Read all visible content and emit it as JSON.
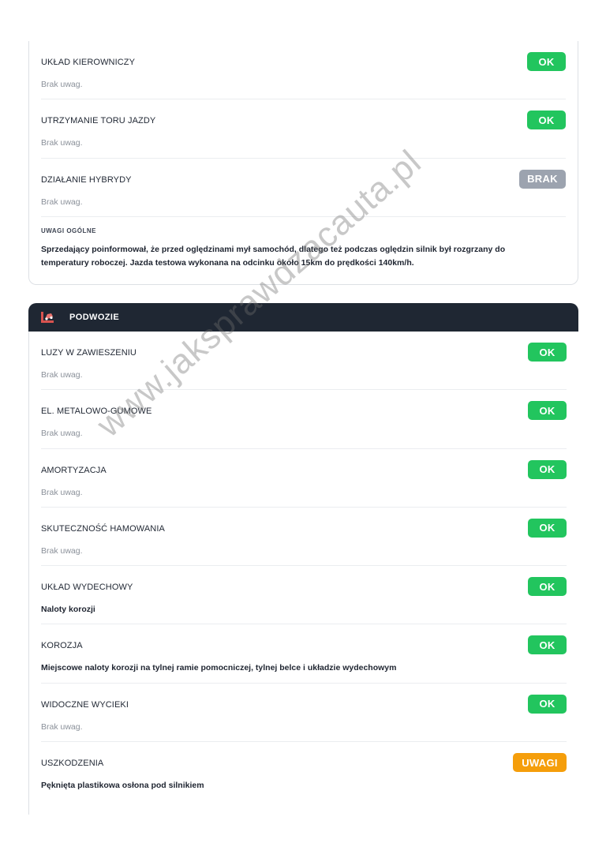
{
  "top_section": {
    "rows": [
      {
        "title": "UKŁAD KIEROWNICZY",
        "note": "Brak uwag.",
        "status": "OK"
      },
      {
        "title": "UTRZYMANIE TORU JAZDY",
        "note": "Brak uwag.",
        "status": "OK"
      },
      {
        "title": "DZIAŁANIE HYBRYDY",
        "note": "Brak uwag.",
        "status": "BRAK"
      }
    ],
    "general_notes": {
      "title": "UWAGI OGÓLNE",
      "text": "Sprzedający poinformował, że przed oględzinami mył samochód, dlatego też podczas oględzin silnik był rozgrzany do temperatury roboczej. Jazda testowa wykonana na odcinku około 15km do prędkości 140km/h."
    }
  },
  "chassis_section": {
    "title": "PODWOZIE",
    "icon": "car-lift-icon",
    "rows": [
      {
        "title": "LUZY W ZAWIESZENIU",
        "note": "Brak uwag.",
        "status": "OK"
      },
      {
        "title": "EL. METALOWO-GUMOWE",
        "note": "Brak uwag.",
        "status": "OK"
      },
      {
        "title": "AMORTYZACJA",
        "note": "Brak uwag.",
        "status": "OK"
      },
      {
        "title": "SKUTECZNOŚĆ HAMOWANIA",
        "note": "Brak uwag.",
        "status": "OK"
      },
      {
        "title": "UKŁAD WYDECHOWY",
        "note": "Naloty korozji",
        "status": "OK"
      },
      {
        "title": "KOROZJA",
        "note": "Miejscowe naloty korozji na tylnej ramie pomocniczej, tylnej belce i układzie wydechowym",
        "status": "OK"
      },
      {
        "title": "WIDOCZNE WYCIEKI",
        "note": "Brak uwag.",
        "status": "OK"
      },
      {
        "title": "USZKODZENIA",
        "note": "Pęknięta plastikowa osłona pod silnikiem",
        "status": "UWAGI"
      }
    ]
  },
  "watermark": "www.jaksprawdzacauta.pl",
  "colors": {
    "ok": "#22c55e",
    "brak": "#9ca3af",
    "uwagi": "#f59e0b",
    "header_bg": "#1f2733",
    "icon_accent": "#d9534f"
  }
}
